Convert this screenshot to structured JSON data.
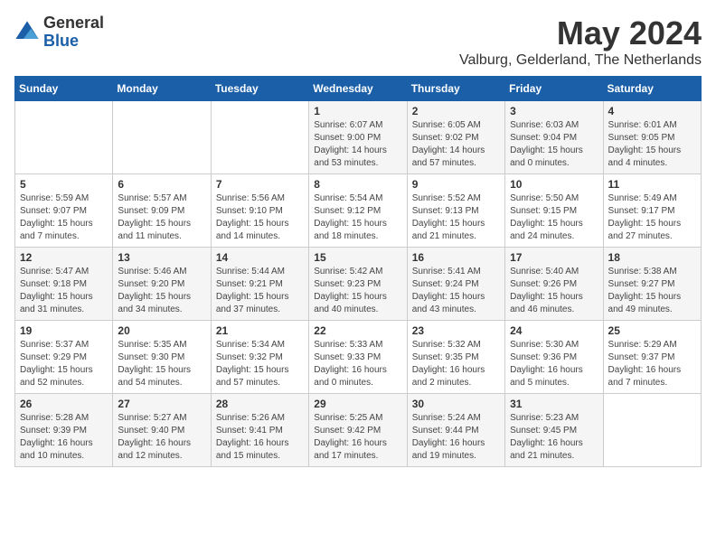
{
  "logo": {
    "general": "General",
    "blue": "Blue"
  },
  "title": {
    "month_year": "May 2024",
    "location": "Valburg, Gelderland, The Netherlands"
  },
  "headers": [
    "Sunday",
    "Monday",
    "Tuesday",
    "Wednesday",
    "Thursday",
    "Friday",
    "Saturday"
  ],
  "weeks": [
    [
      {
        "day": "",
        "info": ""
      },
      {
        "day": "",
        "info": ""
      },
      {
        "day": "",
        "info": ""
      },
      {
        "day": "1",
        "info": "Sunrise: 6:07 AM\nSunset: 9:00 PM\nDaylight: 14 hours and 53 minutes."
      },
      {
        "day": "2",
        "info": "Sunrise: 6:05 AM\nSunset: 9:02 PM\nDaylight: 14 hours and 57 minutes."
      },
      {
        "day": "3",
        "info": "Sunrise: 6:03 AM\nSunset: 9:04 PM\nDaylight: 15 hours and 0 minutes."
      },
      {
        "day": "4",
        "info": "Sunrise: 6:01 AM\nSunset: 9:05 PM\nDaylight: 15 hours and 4 minutes."
      }
    ],
    [
      {
        "day": "5",
        "info": "Sunrise: 5:59 AM\nSunset: 9:07 PM\nDaylight: 15 hours and 7 minutes."
      },
      {
        "day": "6",
        "info": "Sunrise: 5:57 AM\nSunset: 9:09 PM\nDaylight: 15 hours and 11 minutes."
      },
      {
        "day": "7",
        "info": "Sunrise: 5:56 AM\nSunset: 9:10 PM\nDaylight: 15 hours and 14 minutes."
      },
      {
        "day": "8",
        "info": "Sunrise: 5:54 AM\nSunset: 9:12 PM\nDaylight: 15 hours and 18 minutes."
      },
      {
        "day": "9",
        "info": "Sunrise: 5:52 AM\nSunset: 9:13 PM\nDaylight: 15 hours and 21 minutes."
      },
      {
        "day": "10",
        "info": "Sunrise: 5:50 AM\nSunset: 9:15 PM\nDaylight: 15 hours and 24 minutes."
      },
      {
        "day": "11",
        "info": "Sunrise: 5:49 AM\nSunset: 9:17 PM\nDaylight: 15 hours and 27 minutes."
      }
    ],
    [
      {
        "day": "12",
        "info": "Sunrise: 5:47 AM\nSunset: 9:18 PM\nDaylight: 15 hours and 31 minutes."
      },
      {
        "day": "13",
        "info": "Sunrise: 5:46 AM\nSunset: 9:20 PM\nDaylight: 15 hours and 34 minutes."
      },
      {
        "day": "14",
        "info": "Sunrise: 5:44 AM\nSunset: 9:21 PM\nDaylight: 15 hours and 37 minutes."
      },
      {
        "day": "15",
        "info": "Sunrise: 5:42 AM\nSunset: 9:23 PM\nDaylight: 15 hours and 40 minutes."
      },
      {
        "day": "16",
        "info": "Sunrise: 5:41 AM\nSunset: 9:24 PM\nDaylight: 15 hours and 43 minutes."
      },
      {
        "day": "17",
        "info": "Sunrise: 5:40 AM\nSunset: 9:26 PM\nDaylight: 15 hours and 46 minutes."
      },
      {
        "day": "18",
        "info": "Sunrise: 5:38 AM\nSunset: 9:27 PM\nDaylight: 15 hours and 49 minutes."
      }
    ],
    [
      {
        "day": "19",
        "info": "Sunrise: 5:37 AM\nSunset: 9:29 PM\nDaylight: 15 hours and 52 minutes."
      },
      {
        "day": "20",
        "info": "Sunrise: 5:35 AM\nSunset: 9:30 PM\nDaylight: 15 hours and 54 minutes."
      },
      {
        "day": "21",
        "info": "Sunrise: 5:34 AM\nSunset: 9:32 PM\nDaylight: 15 hours and 57 minutes."
      },
      {
        "day": "22",
        "info": "Sunrise: 5:33 AM\nSunset: 9:33 PM\nDaylight: 16 hours and 0 minutes."
      },
      {
        "day": "23",
        "info": "Sunrise: 5:32 AM\nSunset: 9:35 PM\nDaylight: 16 hours and 2 minutes."
      },
      {
        "day": "24",
        "info": "Sunrise: 5:30 AM\nSunset: 9:36 PM\nDaylight: 16 hours and 5 minutes."
      },
      {
        "day": "25",
        "info": "Sunrise: 5:29 AM\nSunset: 9:37 PM\nDaylight: 16 hours and 7 minutes."
      }
    ],
    [
      {
        "day": "26",
        "info": "Sunrise: 5:28 AM\nSunset: 9:39 PM\nDaylight: 16 hours and 10 minutes."
      },
      {
        "day": "27",
        "info": "Sunrise: 5:27 AM\nSunset: 9:40 PM\nDaylight: 16 hours and 12 minutes."
      },
      {
        "day": "28",
        "info": "Sunrise: 5:26 AM\nSunset: 9:41 PM\nDaylight: 16 hours and 15 minutes."
      },
      {
        "day": "29",
        "info": "Sunrise: 5:25 AM\nSunset: 9:42 PM\nDaylight: 16 hours and 17 minutes."
      },
      {
        "day": "30",
        "info": "Sunrise: 5:24 AM\nSunset: 9:44 PM\nDaylight: 16 hours and 19 minutes."
      },
      {
        "day": "31",
        "info": "Sunrise: 5:23 AM\nSunset: 9:45 PM\nDaylight: 16 hours and 21 minutes."
      },
      {
        "day": "",
        "info": ""
      }
    ]
  ]
}
